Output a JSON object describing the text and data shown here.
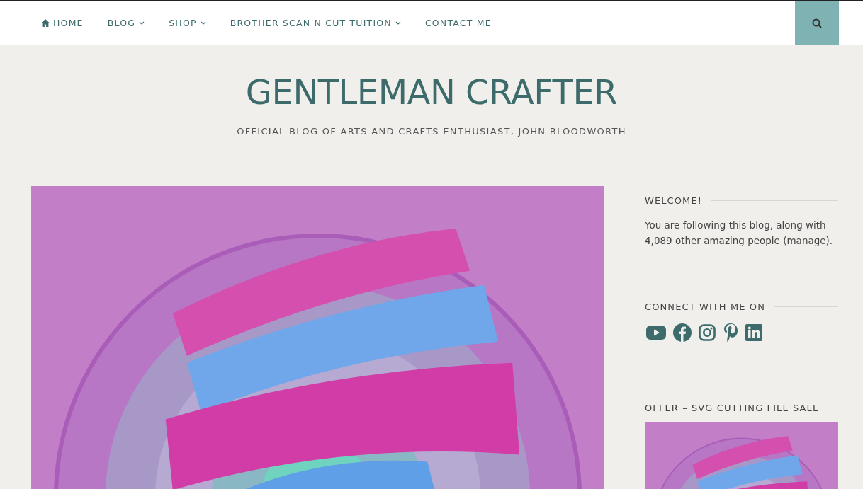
{
  "nav": {
    "items": [
      {
        "label": "HOME",
        "kind": "home",
        "submenu": false
      },
      {
        "label": "BLOG",
        "kind": "menu",
        "submenu": true
      },
      {
        "label": "SHOP",
        "kind": "menu",
        "submenu": true
      },
      {
        "label": "BROTHER SCAN N CUT TUITION",
        "kind": "menu",
        "submenu": true
      },
      {
        "label": "CONTACT ME",
        "kind": "menu",
        "submenu": false
      }
    ]
  },
  "header": {
    "title": "GENTLEMAN CRAFTER",
    "tagline": "OFFICIAL BLOG OF ARTS AND CRAFTS ENTHUSIAST, JOHN BLOODWORTH"
  },
  "sidebar": {
    "widgets": [
      {
        "kind": "text",
        "title": "WELCOME!",
        "text": "You are following this blog, along with 4,089 other amazing people (manage)."
      },
      {
        "kind": "social",
        "title": "CONNECT WITH ME ON",
        "links": [
          {
            "kind": "youtube"
          },
          {
            "kind": "facebook"
          },
          {
            "kind": "instagram"
          },
          {
            "kind": "pinterest"
          },
          {
            "kind": "linkedin"
          }
        ]
      },
      {
        "title": "OFFER – SVG CUTTING FILE SALE"
      }
    ]
  }
}
